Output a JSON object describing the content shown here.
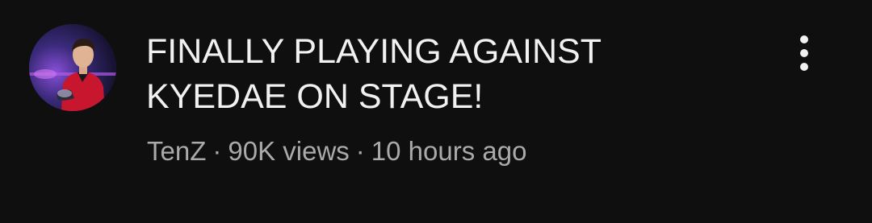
{
  "video": {
    "title": "FINALLY PLAYING AGAINST KYEDAE ON STAGE!",
    "channel": "TenZ",
    "views": "90K views",
    "uploaded": "10 hours ago",
    "separator": "·"
  },
  "icons": {
    "more": "more-vert-icon",
    "avatar": "channel-avatar"
  },
  "colors": {
    "background": "#0f0f0f",
    "title": "#f1f1f1",
    "metadata": "#aaaaaa"
  }
}
